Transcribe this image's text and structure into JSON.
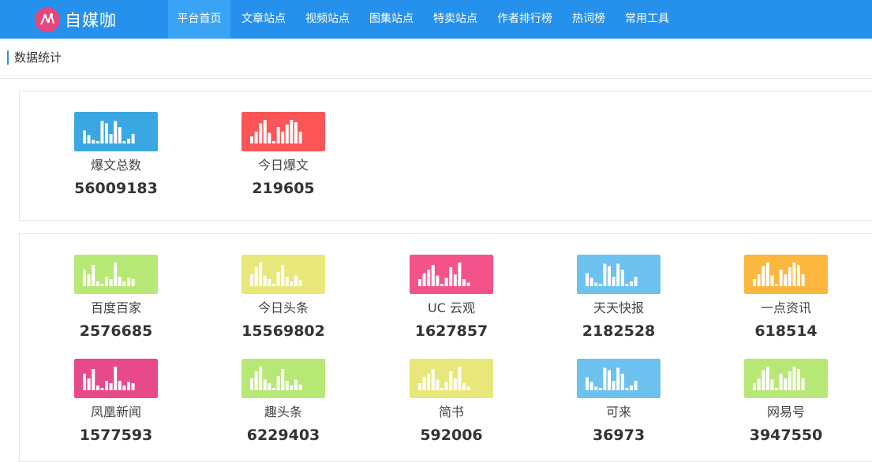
{
  "brand": {
    "logo_text": "自媒咖"
  },
  "nav": {
    "items": [
      {
        "label": "平台首页",
        "active": true
      },
      {
        "label": "文章站点"
      },
      {
        "label": "视频站点"
      },
      {
        "label": "图集站点"
      },
      {
        "label": "特卖站点"
      },
      {
        "label": "作者排行榜"
      },
      {
        "label": "热词榜"
      },
      {
        "label": "常用工具"
      }
    ]
  },
  "section": {
    "title": "数据统计"
  },
  "summary": [
    {
      "label": "爆文总数",
      "value": "56009183",
      "color": "#3aa7e2"
    },
    {
      "label": "今日爆文",
      "value": "219605",
      "color": "#fb5557"
    }
  ],
  "platforms": [
    {
      "label": "百度百家",
      "value": "2576685",
      "color": "#b7e876"
    },
    {
      "label": "今日头条",
      "value": "15569802",
      "color": "#e8e87a"
    },
    {
      "label": "UC 云观",
      "value": "1627857",
      "color": "#f4528a"
    },
    {
      "label": "天天快报",
      "value": "2182528",
      "color": "#6cc1ef"
    },
    {
      "label": "一点资讯",
      "value": "618514",
      "color": "#fbb73e"
    },
    {
      "label": "凤凰新闻",
      "value": "1577593",
      "color": "#e8498a"
    },
    {
      "label": "趣头条",
      "value": "6229403",
      "color": "#b7e876"
    },
    {
      "label": "简书",
      "value": "592006",
      "color": "#e8e87a"
    },
    {
      "label": "可来",
      "value": "36973",
      "color": "#6cc1ef"
    },
    {
      "label": "网易号",
      "value": "3947550",
      "color": "#b7e876"
    }
  ]
}
